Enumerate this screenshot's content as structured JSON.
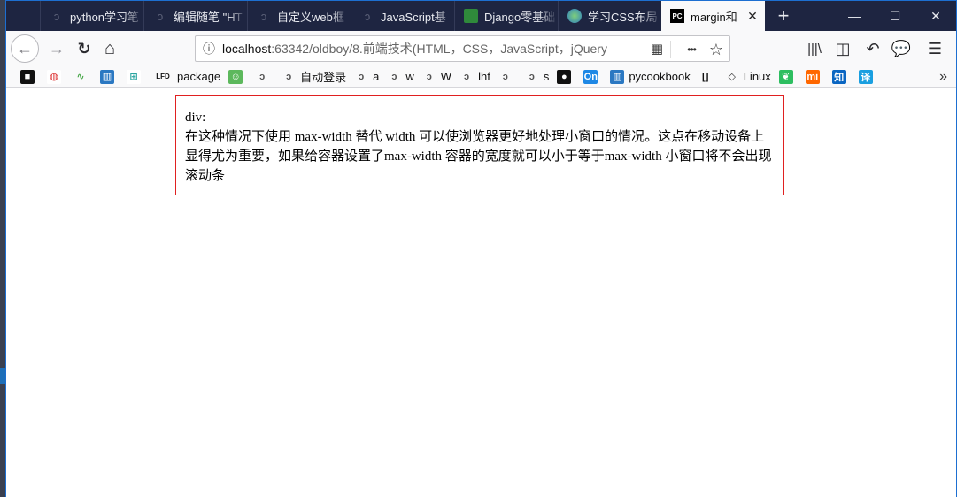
{
  "tabs": [
    {
      "label": "python学习笔",
      "icon": "generic-page-icon",
      "active": false
    },
    {
      "label": "编辑随笔 \"HT",
      "icon": "generic-page-icon",
      "active": false
    },
    {
      "label": "自定义web框",
      "icon": "generic-page-icon",
      "active": false
    },
    {
      "label": "JavaScript基",
      "icon": "generic-page-icon",
      "active": false
    },
    {
      "label": "Django零基础",
      "icon": "django-icon",
      "active": false
    },
    {
      "label": "学习CSS布局",
      "icon": "globe-icon",
      "active": false
    },
    {
      "label": "margin和",
      "icon": "pycharm-icon",
      "active": true
    }
  ],
  "window_controls": {
    "minimize": "—",
    "maximize": "☐",
    "close": "✕"
  },
  "navbar": {
    "url_host": "localhost",
    "url_rest": ":63342/oldboy/8.前端技术(HTML，CSS，JavaScript，jQuery",
    "back_glyph": "←",
    "forward_glyph": "→",
    "reload_glyph": "↻",
    "home_glyph": "⌂",
    "menu_dots": "•••",
    "bookmark_star": "☆"
  },
  "bookmarks": [
    {
      "label": "",
      "icon": "square-icon"
    },
    {
      "label": "",
      "icon": "shield-icon"
    },
    {
      "label": "",
      "icon": "audio-icon"
    },
    {
      "label": "",
      "icon": "book-icon"
    },
    {
      "label": "",
      "icon": "grid-icon"
    },
    {
      "label": "package",
      "icon": "lfd-icon",
      "badge": "LFD"
    },
    {
      "label": "",
      "icon": "face-icon"
    },
    {
      "label": "",
      "icon": "generic-page-icon"
    },
    {
      "label": "自动登录",
      "icon": "generic-page-icon"
    },
    {
      "label": "a",
      "icon": "generic-page-icon"
    },
    {
      "label": "w",
      "icon": "generic-page-icon"
    },
    {
      "label": "W",
      "icon": "generic-page-icon"
    },
    {
      "label": "lhf",
      "icon": "generic-page-icon"
    },
    {
      "label": "",
      "icon": "generic-page-icon"
    },
    {
      "label": "s",
      "icon": "generic-page-icon"
    },
    {
      "label": "",
      "icon": "person-icon"
    },
    {
      "label": "",
      "icon": "on-icon",
      "badge": "On"
    },
    {
      "label": "pycookbook",
      "icon": "book-icon"
    },
    {
      "label": "",
      "icon": "brackets-icon"
    },
    {
      "label": "Linux",
      "icon": "diamond-icon"
    },
    {
      "label": "",
      "icon": "evernote-icon"
    },
    {
      "label": "",
      "icon": "mi-icon",
      "badge": "mi"
    },
    {
      "label": "",
      "icon": "zhihu-icon",
      "badge": "知"
    },
    {
      "label": "",
      "icon": "translate-icon",
      "badge": "译"
    }
  ],
  "bookmarks_overflow": "»",
  "content": {
    "div_label": "div:",
    "div_text": "在这种情况下使用 max-width 替代 width 可以使浏览器更好地处理小窗口的情况。这点在移动设备上显得尤为重要，如果给容器设置了max-width 容器的宽度就可以小于等于max-width 小窗口将不会出现滚动条"
  },
  "colors": {
    "tabbar_bg": "#1e2541",
    "active_tab_bg": "#f9f9fa",
    "div_border": "#e02020",
    "window_border": "#1d6fd1"
  }
}
